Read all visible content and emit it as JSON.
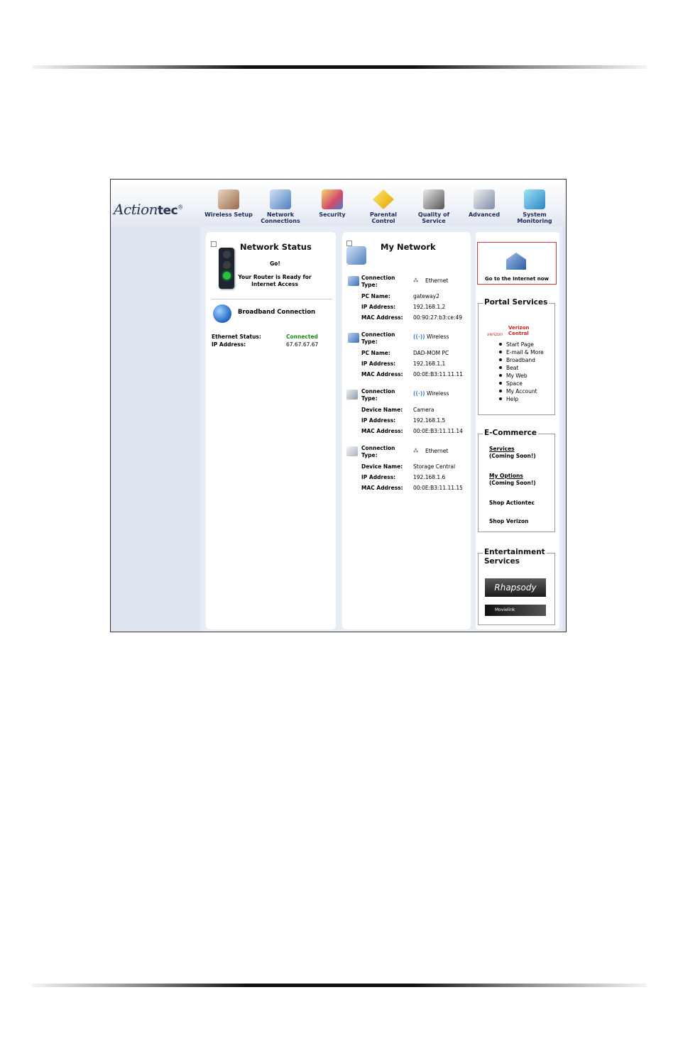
{
  "colors": {
    "nav_label": "#1b2a55",
    "connected": "#1a8a1a",
    "go_internet_border": "#d9343a",
    "verizon_red": "#cc1f26"
  },
  "brand": {
    "logo_text_italic": "Action",
    "logo_text_bold": "tec",
    "logo_mark": "®"
  },
  "nav": [
    {
      "label_lines": [
        "Wireless Setup"
      ],
      "icon": "wireless-setup-icon"
    },
    {
      "label_lines": [
        "Network",
        "Connections"
      ],
      "icon": "network-connections-icon"
    },
    {
      "label_lines": [
        "Security"
      ],
      "icon": "security-icon"
    },
    {
      "label_lines": [
        "Parental",
        "Control"
      ],
      "icon": "parental-control-icon"
    },
    {
      "label_lines": [
        "Quality of",
        "Service"
      ],
      "icon": "quality-of-service-icon"
    },
    {
      "label_lines": [
        "Advanced"
      ],
      "icon": "advanced-icon"
    },
    {
      "label_lines": [
        "System",
        "Monitoring"
      ],
      "icon": "system-monitoring-icon"
    }
  ],
  "network_status": {
    "title": "Network Status",
    "go": "Go!",
    "ready_line1": "Your Router is Ready for",
    "ready_line2": "Internet Access",
    "broadband_title": "Broadband Connection",
    "ethernet_status_label": "Ethernet Status:",
    "ethernet_status_value": "Connected",
    "ip_label": "IP Address:",
    "ip_value": "67.67.67.67"
  },
  "my_network": {
    "title": "My Network",
    "devices": [
      {
        "conn_label_1": "Connection",
        "conn_label_2": "Type:",
        "conn_type": "Ethernet",
        "conn_icon": "ethernet-icon",
        "name_label": "PC Name:",
        "name_value": "gateway2",
        "ip_label": "IP Address:",
        "ip_value": "192.168.1.2",
        "mac_label": "MAC Address:",
        "mac_value": "00:90:27:b3:ce:49",
        "device_icon": "computer-icon"
      },
      {
        "conn_label_1": "Connection",
        "conn_label_2": "Type:",
        "conn_type": "Wireless",
        "conn_icon": "wireless-signal-icon",
        "name_label": "PC Name:",
        "name_value": "DAD-MOM PC",
        "ip_label": "IP Address:",
        "ip_value": "192.168.1.1",
        "mac_label": "MAC Address:",
        "mac_value": "00:0E:B3:11.11.11",
        "device_icon": "computer-icon"
      },
      {
        "conn_label_1": "Connection",
        "conn_label_2": "Type:",
        "conn_type": "Wireless",
        "conn_icon": "wireless-signal-icon",
        "name_label": "Device Name:",
        "name_value": "Camera",
        "ip_label": "IP Address:",
        "ip_value": "192.168.1.5",
        "mac_label": "MAC Address:",
        "mac_value": "00:0E:B3:11.11.14",
        "device_icon": "camera-icon"
      },
      {
        "conn_label_1": "Connection",
        "conn_label_2": "Type:",
        "conn_type": "Ethernet",
        "conn_icon": "ethernet-icon",
        "name_label": "Device Name:",
        "name_value": "Storage Central",
        "ip_label": "IP Address:",
        "ip_value": "192.168.1.6",
        "mac_label": "MAC Address:",
        "mac_value": "00:0E:B3:11.11.15",
        "device_icon": "storage-icon"
      }
    ]
  },
  "right": {
    "go_internet": "Go to the Internet now",
    "portal": {
      "title": "Portal Services",
      "verizon_small": "verizon",
      "verizon_label": "Verizon Central",
      "items": [
        "Start Page",
        "E-mail & More",
        "Broadband",
        "Beat",
        "My Web",
        "Space",
        "My Account",
        "Help"
      ]
    },
    "ecommerce": {
      "title": "E-Commerce",
      "services_link": "Services",
      "services_note": "(Coming Soon!)",
      "options_link": "My Options",
      "options_note": "(Coming Soon!)",
      "shop_actiontec": "Shop Actiontec",
      "shop_verizon": "Shop Verizon"
    },
    "entertainment": {
      "title_line1": "Entertainment",
      "title_line2": "Services",
      "rhapsody": "Rhapsody",
      "movielink": "Movielink"
    }
  }
}
